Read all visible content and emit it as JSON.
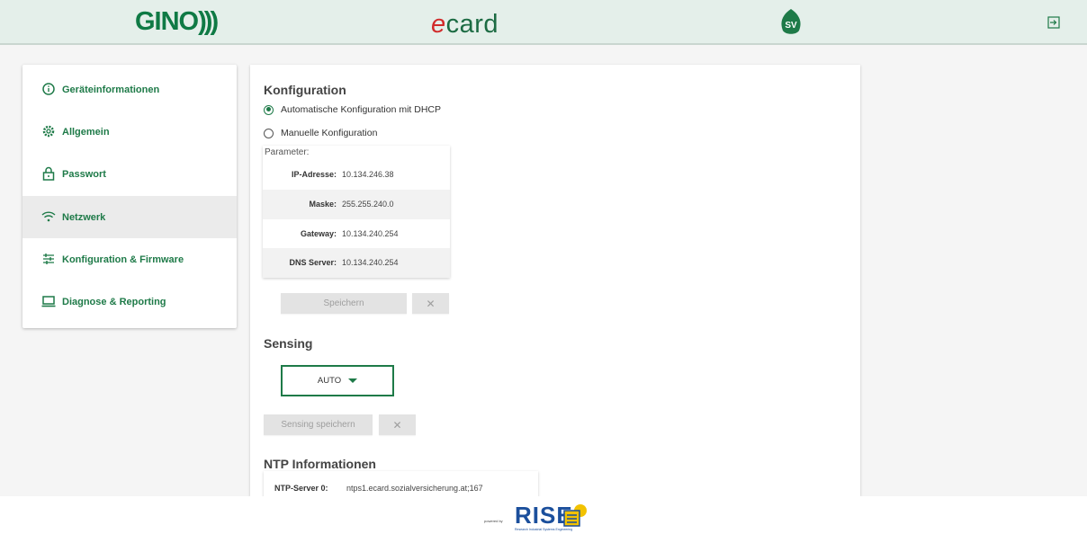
{
  "header": {
    "logo_gino_text": "GINO",
    "logo_gino_waves": ")))",
    "logo_ecard_e": "e",
    "logo_ecard_rest": "card",
    "logo_sv": "SV",
    "logout_icon": "logout-icon"
  },
  "sidebar": {
    "items": [
      {
        "label": "Geräteinformationen",
        "icon": "info-icon",
        "active": false
      },
      {
        "label": "Allgemein",
        "icon": "gear-icon",
        "active": false
      },
      {
        "label": "Passwort",
        "icon": "lock-icon",
        "active": false
      },
      {
        "label": "Netzwerk",
        "icon": "wifi-icon",
        "active": true
      },
      {
        "label": "Konfiguration & Firmware",
        "icon": "sliders-icon",
        "active": false
      },
      {
        "label": "Diagnose & Reporting",
        "icon": "laptop-icon",
        "active": false
      }
    ]
  },
  "konfiguration": {
    "title": "Konfiguration",
    "radio_dhcp": "Automatische Konfiguration mit DHCP",
    "radio_manual": "Manuelle Konfiguration",
    "selected": "dhcp",
    "parameter_heading": "Parameter:",
    "params": [
      {
        "key": "IP-Adresse:",
        "value": "10.134.246.38"
      },
      {
        "key": "Maske:",
        "value": "255.255.240.0"
      },
      {
        "key": "Gateway:",
        "value": "10.134.240.254"
      },
      {
        "key": "DNS Server:",
        "value": "10.134.240.254"
      }
    ],
    "save_label": "Speichern",
    "cancel_label": "✕"
  },
  "sensing": {
    "title": "Sensing",
    "select_value": "AUTO",
    "save_label": "Sensing speichern",
    "cancel_label": "✕"
  },
  "ntp": {
    "title": "NTP Informationen",
    "server_key": "NTP-Server 0:",
    "server_value": "ntps1.ecard.sozialversicherung.at;167"
  },
  "footer": {
    "powered_by": "powered by",
    "brand": "RISE",
    "brand_sub": "Research Industrial Systems Engineering"
  },
  "colors": {
    "brand_green": "#1e7a48",
    "header_bg": "#e4efea",
    "rise_blue": "#1b4f9c"
  }
}
